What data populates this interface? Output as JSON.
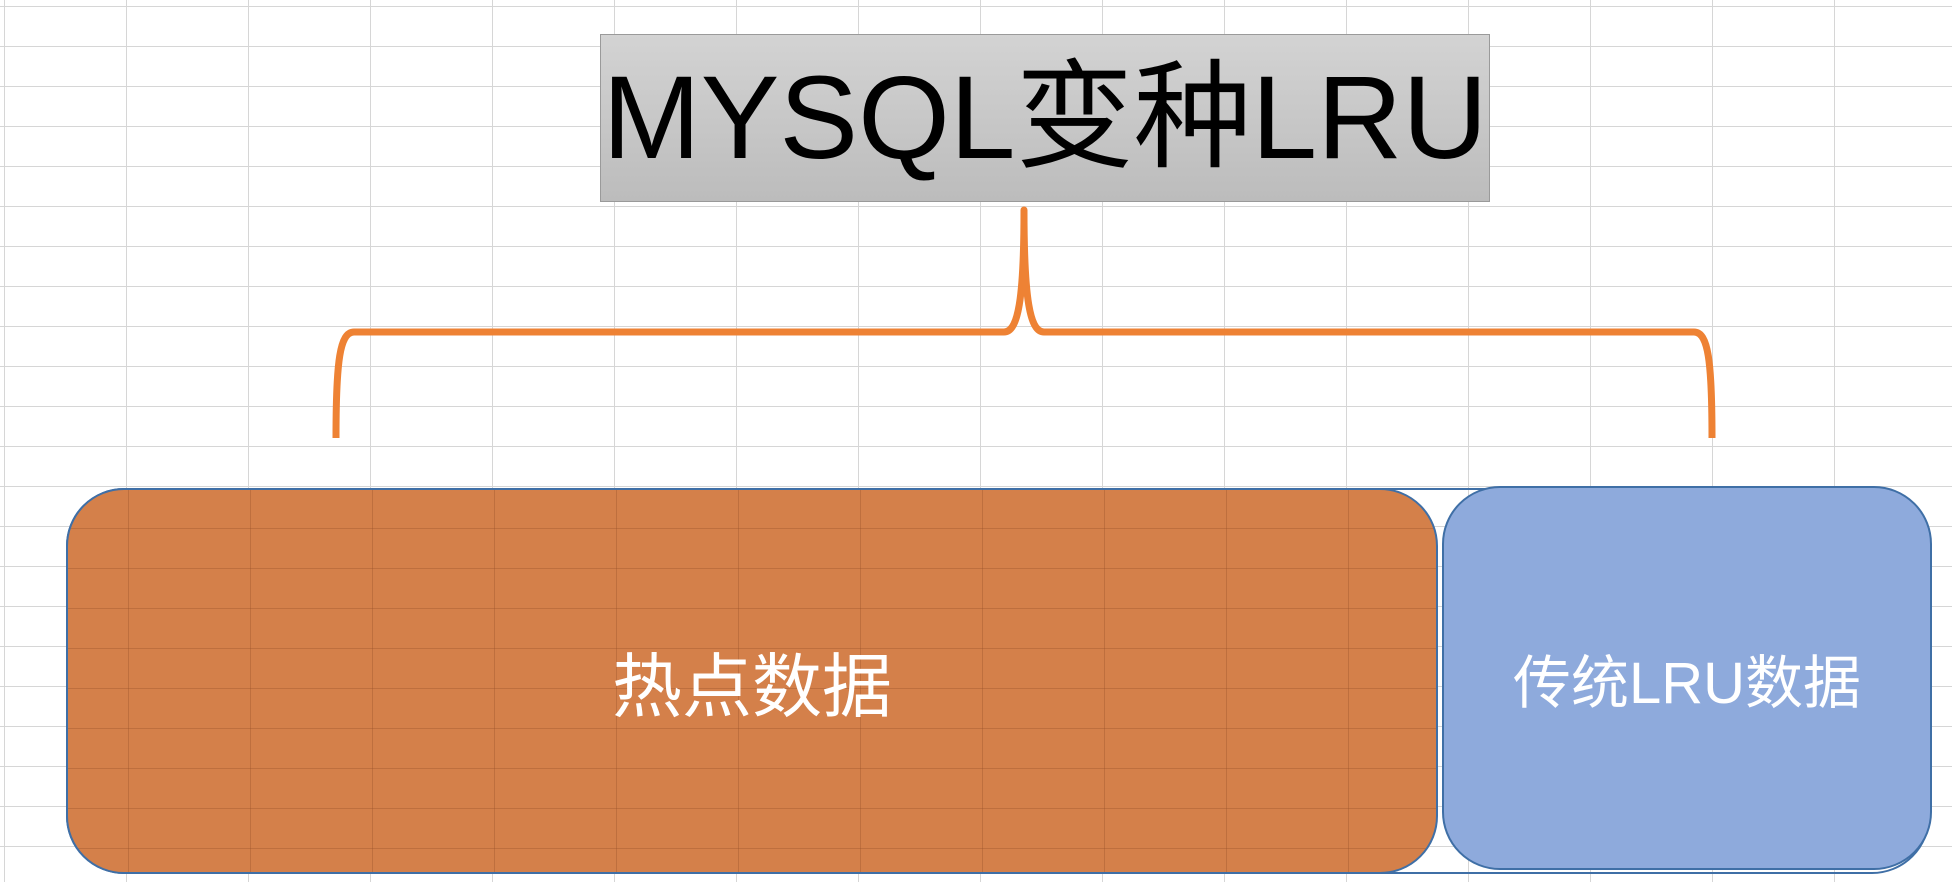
{
  "title": "MYSQL变种LRU",
  "segments": {
    "hot": "热点数据",
    "lru": "传统LRU数据"
  },
  "colors": {
    "title_bg": "#c8c8c8",
    "hot_fill": "#d4804a",
    "lru_fill": "#8eaadc",
    "border": "#3f6fa6",
    "brace": "#ee8234"
  }
}
